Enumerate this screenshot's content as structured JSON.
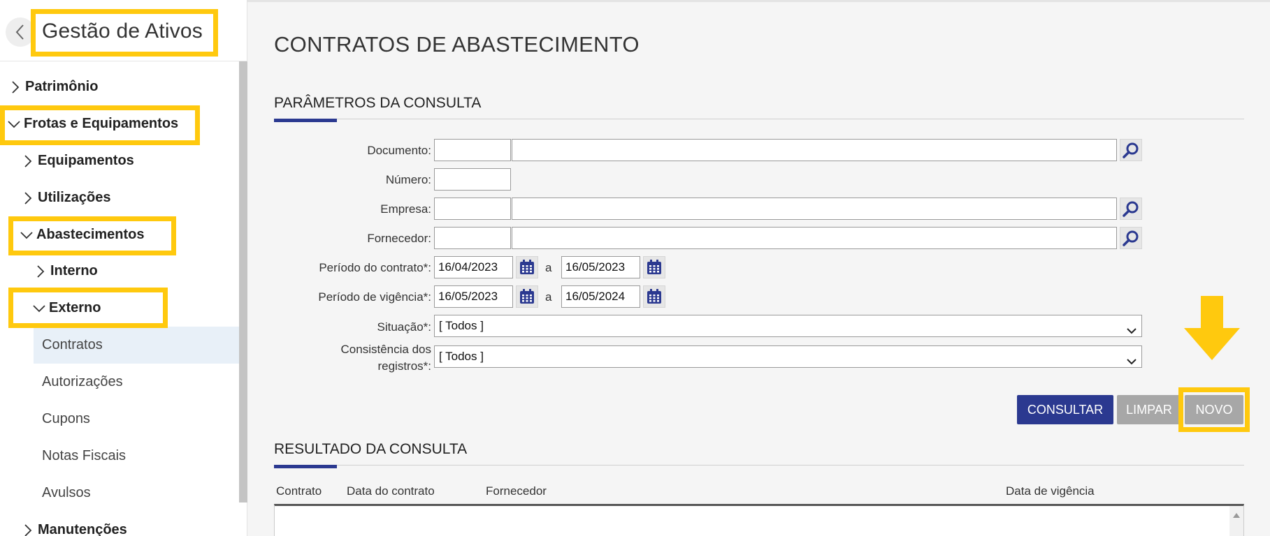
{
  "sidebar": {
    "title": "Gestão de Ativos",
    "items": {
      "patrimonio": "Patrimônio",
      "frotas": "Frotas e Equipamentos",
      "equipamentos": "Equipamentos",
      "utilizacoes": "Utilizações",
      "abastecimentos": "Abastecimentos",
      "interno": "Interno",
      "externo": "Externo",
      "contratos": "Contratos",
      "autorizacoes": "Autorizações",
      "cupons": "Cupons",
      "notas": "Notas Fiscais",
      "avulsos": "Avulsos",
      "manutencoes": "Manutenções"
    },
    "active_item": "Contratos"
  },
  "page": {
    "title": "CONTRATOS DE ABASTECIMENTO"
  },
  "params": {
    "section_title": "PARÂMETROS DA CONSULTA",
    "labels": {
      "documento": "Documento:",
      "numero": "Número:",
      "empresa": "Empresa:",
      "fornecedor": "Fornecedor:",
      "periodo_contrato": "Período do contrato*:",
      "periodo_vigencia": "Período de vigência*:",
      "situacao": "Situação*:",
      "consistencia_1": "Consistência dos",
      "consistencia_2": "registros*:"
    },
    "values": {
      "documento_code": "",
      "documento_desc": "",
      "numero": "",
      "empresa_code": "",
      "empresa_desc": "",
      "fornecedor_code": "",
      "fornecedor_desc": "",
      "contrato_inicio": "16/04/2023",
      "contrato_fim": "16/05/2023",
      "vigencia_inicio": "16/05/2023",
      "vigencia_fim": "16/05/2024",
      "situacao": "[ Todos ]",
      "consistencia": "[ Todos ]"
    },
    "range_separator": "a"
  },
  "buttons": {
    "consultar": "CONSULTAR",
    "limpar": "LIMPAR",
    "novo": "NOVO"
  },
  "results": {
    "section_title": "RESULTADO DA CONSULTA",
    "columns": {
      "contrato": "Contrato",
      "data_contrato": "Data do contrato",
      "fornecedor": "Fornecedor",
      "data_vigencia": "Data de vigência"
    }
  },
  "colors": {
    "primary": "#2b3990",
    "highlight": "#ffc90e",
    "button_gray": "#a7a7a7",
    "active_item_bg": "#e8f0f8"
  },
  "icons": {
    "search": "magnifier-icon",
    "calendar": "calendar-icon",
    "back": "chevron-left-icon",
    "expand": "chevron-right-icon",
    "collapse": "chevron-down-icon",
    "annotation": "arrow-down-icon"
  }
}
